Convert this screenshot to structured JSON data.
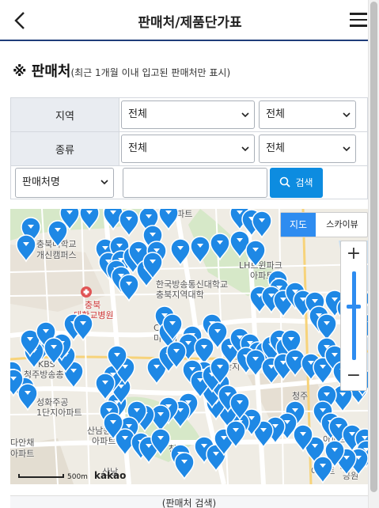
{
  "header": {
    "title": "판매처/제품단가표",
    "back_icon": "chevron-left-icon",
    "menu_icon": "hamburger-menu-icon"
  },
  "section": {
    "mark": "※",
    "title": "판매처",
    "note": "(최근 1개월 이내 입고된 판매처만 표시)"
  },
  "filters": {
    "region": {
      "label": "지역",
      "select1": "전체",
      "select2": "전체"
    },
    "type": {
      "label": "종류",
      "select1": "전체",
      "select2": "전체"
    },
    "name": {
      "select": "판매처명",
      "input_value": "",
      "search_label": "검색",
      "search_icon": "search-icon"
    }
  },
  "map": {
    "type_map": "지도",
    "type_sky": "스카이뷰",
    "zoom_in": "+",
    "zoom_out": "−",
    "scale": "500m",
    "provider": "kakao",
    "labels": {
      "l1": "충북대학교",
      "l2": "개신캠퍼스",
      "l3": "충북",
      "l4": "대학교병원",
      "l5": "한국방송통신대학교",
      "l6": "충북지역대학",
      "l7": "LH트윈파크",
      "l8": "아파트",
      "l9": "CJ",
      "l10": "미디어",
      "l11": "산남",
      "l12": "1단지아",
      "l13": "KBS",
      "l14": "청주방송총국",
      "l15": "성화주공",
      "l16": "1단지아파트",
      "l17": "다안채",
      "l18": "아파트",
      "l19": "산남퀸즈",
      "l20": "아파트",
      "l21": "청주",
      "l22": "메가",
      "l23": "아파트",
      "l24": "청주",
      "l25": "버밀",
      "l26": "산남",
      "l27": "아파트",
      "l28": "청주",
      "l29": "공원",
      "l30": "아파트"
    },
    "marker_icon": "map-pin-icon",
    "road_color": "#ffffff",
    "park_color": "#d6e8c8",
    "water_color": "#c9def0",
    "marker_color": "#1e88e5"
  },
  "footer": {
    "label": "(판매처 검색)"
  }
}
